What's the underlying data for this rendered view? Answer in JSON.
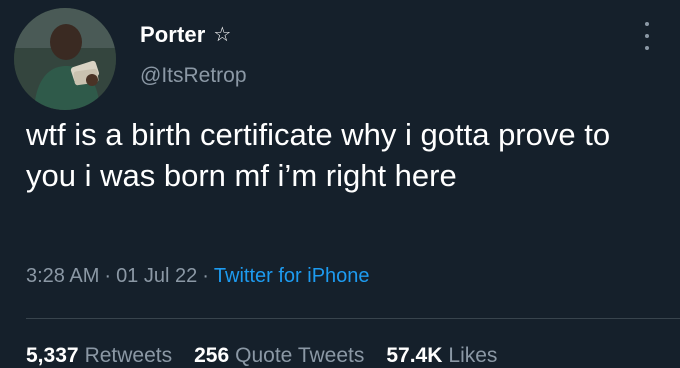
{
  "user": {
    "display_name": "Porter",
    "badge_icon": "star-outline-icon",
    "handle": "@ItsRetrop"
  },
  "tweet": {
    "text": "wtf is a birth certificate why i gotta prove to you i was born mf i’m right here",
    "time": "3:28 AM",
    "date": "01 Jul 22",
    "source": "Twitter for iPhone"
  },
  "stats": {
    "retweets_count": "5,337",
    "retweets_label": "Retweets",
    "quotes_count": "256",
    "quotes_label": "Quote Tweets",
    "likes_count": "57.4K",
    "likes_label": "Likes"
  },
  "colors": {
    "background": "#15202b",
    "text": "#ffffff",
    "secondary": "#8b98a5",
    "link": "#1d9bf0"
  }
}
